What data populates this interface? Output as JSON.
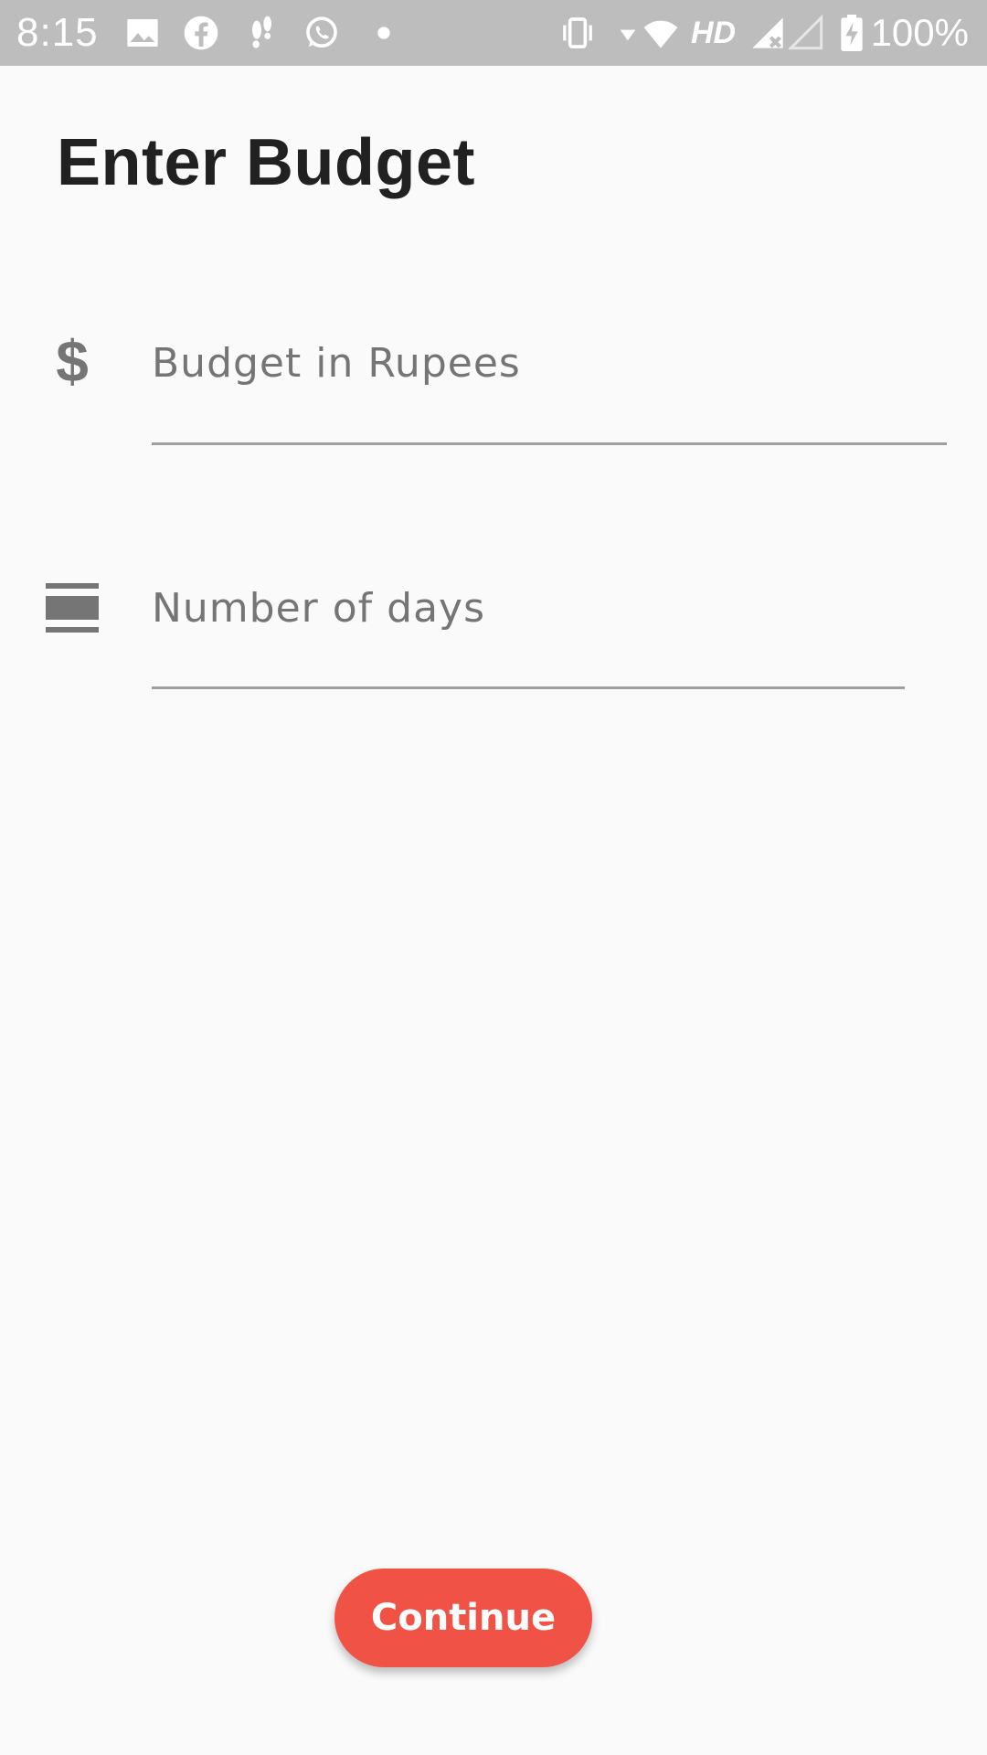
{
  "status_bar": {
    "time": "8:15",
    "network_label": "HD",
    "battery_percent": "100%",
    "icons": [
      "gallery-icon",
      "facebook-icon",
      "footsteps-icon",
      "whatsapp-icon",
      "dot-icon",
      "vibrate-icon",
      "wifi-icon",
      "signal-no-data-icon",
      "signal-empty-icon",
      "battery-charging-icon"
    ]
  },
  "page": {
    "title": "Enter Budget"
  },
  "form": {
    "budget": {
      "placeholder": "Budget in Rupees",
      "value": "",
      "icon": "dollar-icon",
      "icon_glyph": "$"
    },
    "days": {
      "placeholder": "Number of days",
      "value": "",
      "icon": "calendar-view-day-icon"
    }
  },
  "actions": {
    "continue_label": "Continue"
  },
  "colors": {
    "status_bar_bg": "#bdbdbd",
    "background": "#fafafa",
    "accent": "#f05245",
    "title": "#212121",
    "hint": "#757575",
    "underline": "#9e9e9e"
  }
}
